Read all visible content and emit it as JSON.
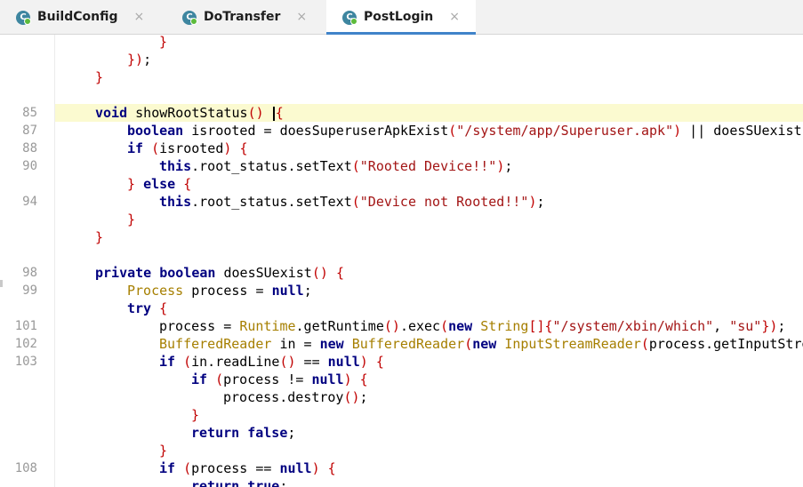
{
  "tabs": [
    {
      "label": "BuildConfig",
      "icon": "java-class-icon",
      "active": false
    },
    {
      "label": "DoTransfer",
      "icon": "java-class-icon",
      "active": false
    },
    {
      "label": "PostLogin",
      "icon": "java-class-icon",
      "active": true
    }
  ],
  "tab_icon_glyph": "C",
  "tab_close_glyph": "×",
  "colors": {
    "keyword": "#000080",
    "string": "#a31515",
    "type": "#a67f00",
    "bracket": "#c00000",
    "current_line": "#fbfad0",
    "active_tab_underline": "#4083c9"
  },
  "code_lines": [
    {
      "num": "",
      "indent": 3,
      "tokens": [
        [
          "}",
          "br"
        ]
      ]
    },
    {
      "num": "",
      "indent": 2,
      "tokens": [
        [
          "})",
          "br"
        ],
        [
          ";",
          ""
        ]
      ]
    },
    {
      "num": "",
      "indent": 1,
      "tokens": [
        [
          "}",
          "br"
        ]
      ]
    },
    {
      "num": "",
      "indent": 0,
      "tokens": []
    },
    {
      "num": "85",
      "indent": 1,
      "highlight": true,
      "caret_after": 3,
      "tokens": [
        [
          "void",
          "kw"
        ],
        [
          " showRootStatus",
          ""
        ],
        [
          "()",
          "br"
        ],
        [
          " ",
          ""
        ],
        [
          "{",
          "br"
        ]
      ]
    },
    {
      "num": "87",
      "indent": 2,
      "tokens": [
        [
          "boolean",
          "kw"
        ],
        [
          " isrooted = doesSuperuserApkExist",
          ""
        ],
        [
          "(",
          "br"
        ],
        [
          "\"/system/app/Superuser.apk\"",
          "str"
        ],
        [
          ")",
          "br"
        ],
        [
          " || doesSUexist",
          ""
        ],
        [
          "(",
          "br"
        ]
      ]
    },
    {
      "num": "88",
      "indent": 2,
      "tokens": [
        [
          "if",
          "kw"
        ],
        [
          " ",
          ""
        ],
        [
          "(",
          "br"
        ],
        [
          "isrooted",
          ""
        ],
        [
          ")",
          "br"
        ],
        [
          " ",
          ""
        ],
        [
          "{",
          "br"
        ]
      ]
    },
    {
      "num": "90",
      "indent": 3,
      "tokens": [
        [
          "this",
          "kw"
        ],
        [
          ".root_status.setText",
          ""
        ],
        [
          "(",
          "br"
        ],
        [
          "\"Rooted Device!!\"",
          "str"
        ],
        [
          ")",
          "br"
        ],
        [
          ";",
          ""
        ]
      ]
    },
    {
      "num": "",
      "indent": 2,
      "tokens": [
        [
          "}",
          "br"
        ],
        [
          " ",
          ""
        ],
        [
          "else",
          "kw"
        ],
        [
          " ",
          ""
        ],
        [
          "{",
          "br"
        ]
      ]
    },
    {
      "num": "94",
      "indent": 3,
      "tokens": [
        [
          "this",
          "kw"
        ],
        [
          ".root_status.setText",
          ""
        ],
        [
          "(",
          "br"
        ],
        [
          "\"Device not Rooted!!\"",
          "str"
        ],
        [
          ")",
          "br"
        ],
        [
          ";",
          ""
        ]
      ]
    },
    {
      "num": "",
      "indent": 2,
      "tokens": [
        [
          "}",
          "br"
        ]
      ]
    },
    {
      "num": "",
      "indent": 1,
      "tokens": [
        [
          "}",
          "br"
        ]
      ]
    },
    {
      "num": "",
      "indent": 0,
      "tokens": []
    },
    {
      "num": "98",
      "indent": 1,
      "tokens": [
        [
          "private",
          "kw"
        ],
        [
          " ",
          ""
        ],
        [
          "boolean",
          "kw"
        ],
        [
          " doesSUexist",
          ""
        ],
        [
          "()",
          "br"
        ],
        [
          " ",
          ""
        ],
        [
          "{",
          "br"
        ]
      ]
    },
    {
      "num": "99",
      "indent": 2,
      "tokens": [
        [
          "Process",
          "type"
        ],
        [
          " process = ",
          ""
        ],
        [
          "null",
          "kw"
        ],
        [
          ";",
          ""
        ]
      ]
    },
    {
      "num": "",
      "indent": 2,
      "tokens": [
        [
          "try",
          "kw"
        ],
        [
          " ",
          ""
        ],
        [
          "{",
          "br"
        ]
      ]
    },
    {
      "num": "101",
      "indent": 3,
      "tokens": [
        [
          "process = ",
          ""
        ],
        [
          "Runtime",
          "type"
        ],
        [
          ".getRuntime",
          ""
        ],
        [
          "()",
          "br"
        ],
        [
          ".exec",
          ""
        ],
        [
          "(",
          "br"
        ],
        [
          "new",
          "kw"
        ],
        [
          " ",
          ""
        ],
        [
          "String",
          "type"
        ],
        [
          "[]{",
          "br"
        ],
        [
          "\"/system/xbin/which\"",
          "str"
        ],
        [
          ", ",
          ""
        ],
        [
          "\"su\"",
          "str"
        ],
        [
          "})",
          "br"
        ],
        [
          ";",
          ""
        ]
      ]
    },
    {
      "num": "102",
      "indent": 3,
      "tokens": [
        [
          "BufferedReader",
          "type"
        ],
        [
          " in = ",
          ""
        ],
        [
          "new",
          "kw"
        ],
        [
          " ",
          ""
        ],
        [
          "BufferedReader",
          "type"
        ],
        [
          "(",
          "br"
        ],
        [
          "new",
          "kw"
        ],
        [
          " ",
          ""
        ],
        [
          "InputStreamReader",
          "type"
        ],
        [
          "(",
          "br"
        ],
        [
          "process.getInputStre",
          ""
        ]
      ]
    },
    {
      "num": "103",
      "indent": 3,
      "tokens": [
        [
          "if",
          "kw"
        ],
        [
          " ",
          ""
        ],
        [
          "(",
          "br"
        ],
        [
          "in.readLine",
          ""
        ],
        [
          "()",
          "br"
        ],
        [
          " == ",
          ""
        ],
        [
          "null",
          "kw"
        ],
        [
          ")",
          "br"
        ],
        [
          " ",
          ""
        ],
        [
          "{",
          "br"
        ]
      ]
    },
    {
      "num": "",
      "indent": 4,
      "tokens": [
        [
          "if",
          "kw"
        ],
        [
          " ",
          ""
        ],
        [
          "(",
          "br"
        ],
        [
          "process != ",
          ""
        ],
        [
          "null",
          "kw"
        ],
        [
          ")",
          "br"
        ],
        [
          " ",
          ""
        ],
        [
          "{",
          "br"
        ]
      ]
    },
    {
      "num": "",
      "indent": 5,
      "tokens": [
        [
          "process.destroy",
          ""
        ],
        [
          "()",
          "br"
        ],
        [
          ";",
          ""
        ]
      ]
    },
    {
      "num": "",
      "indent": 4,
      "tokens": [
        [
          "}",
          "br"
        ]
      ]
    },
    {
      "num": "",
      "indent": 4,
      "tokens": [
        [
          "return",
          "kw"
        ],
        [
          " ",
          ""
        ],
        [
          "false",
          "kw"
        ],
        [
          ";",
          ""
        ]
      ]
    },
    {
      "num": "",
      "indent": 3,
      "tokens": [
        [
          "}",
          "br"
        ]
      ]
    },
    {
      "num": "108",
      "indent": 3,
      "tokens": [
        [
          "if",
          "kw"
        ],
        [
          " ",
          ""
        ],
        [
          "(",
          "br"
        ],
        [
          "process == ",
          ""
        ],
        [
          "null",
          "kw"
        ],
        [
          ")",
          "br"
        ],
        [
          " ",
          ""
        ],
        [
          "{",
          "br"
        ]
      ]
    },
    {
      "num": "",
      "indent": 4,
      "tokens": [
        [
          "return",
          "kw"
        ],
        [
          " ",
          ""
        ],
        [
          "true",
          "kw"
        ],
        [
          ";",
          ""
        ]
      ]
    }
  ]
}
